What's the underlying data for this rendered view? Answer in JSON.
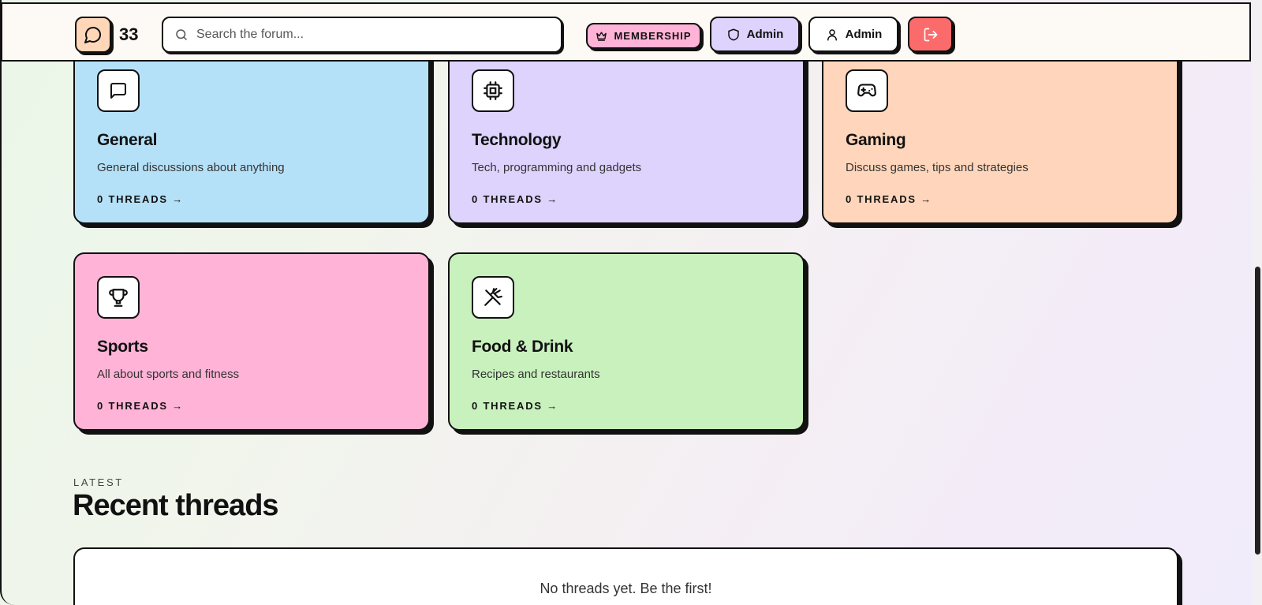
{
  "header": {
    "logo_count": "33",
    "search_placeholder": "Search the forum...",
    "membership_label": "MEMBERSHIP",
    "role_label": "Admin",
    "user_label": "Admin"
  },
  "categories": [
    {
      "title": "General",
      "description": "General discussions about anything",
      "threads": "0 THREADS →",
      "color": "#b5e1f8",
      "icon": "message-square-icon"
    },
    {
      "title": "Technology",
      "description": "Tech, programming and gadgets",
      "threads": "0 THREADS →",
      "color": "#ddd3fd",
      "icon": "cpu-icon"
    },
    {
      "title": "Gaming",
      "description": "Discuss games, tips and strategies",
      "threads": "0 THREADS →",
      "color": "#ffd6bb",
      "icon": "gamepad-icon"
    },
    {
      "title": "Sports",
      "description": "All about sports and fitness",
      "threads": "0 THREADS →",
      "color": "#ffb3d6",
      "icon": "trophy-icon"
    },
    {
      "title": "Food & Drink",
      "description": "Recipes and restaurants",
      "threads": "0 THREADS →",
      "color": "#c8f1bd",
      "icon": "utensils-icon"
    }
  ],
  "latest": {
    "label": "LATEST",
    "title": "Recent threads",
    "empty_message": "No threads yet. Be the first!"
  }
}
